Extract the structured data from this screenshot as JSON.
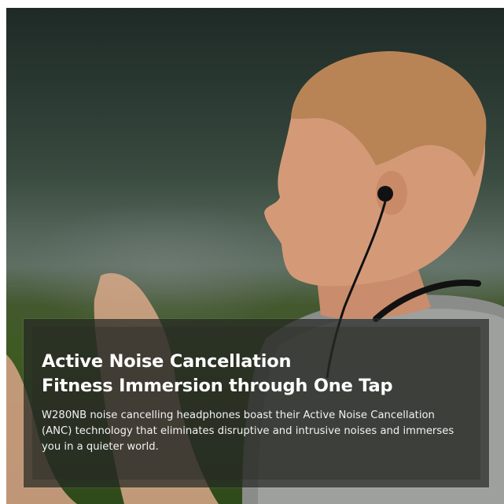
{
  "banner": {
    "headline_line1": "Active Noise Cancellation",
    "headline_line2": "Fitness Immersion through One Tap",
    "body": "W280NB noise cancelling headphones boast their Active Noise Cancellation (ANC) technology that eliminates disruptive and intrusive noises and immerses you in a quieter world."
  },
  "colors": {
    "overlay": "#26282499",
    "text": "#ffffff"
  }
}
